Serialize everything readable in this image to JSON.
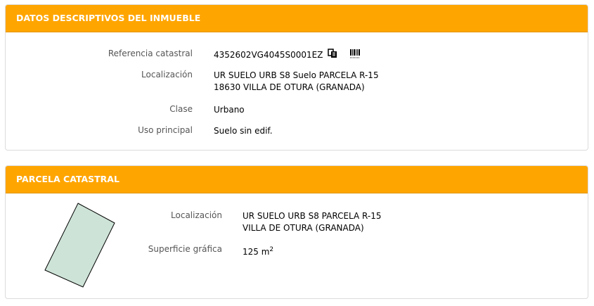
{
  "section1": {
    "title": "DATOS DESCRIPTIVOS DEL INMUEBLE",
    "rows": [
      {
        "label": "Referencia catastral",
        "value": "4352602VG4045S0001EZ"
      },
      {
        "label": "Localización",
        "value_line1": "UR SUELO URB S8 Suelo PARCELA R-15",
        "value_line2": "18630 VILLA DE OTURA (GRANADA)"
      },
      {
        "label": "Clase",
        "value": "Urbano"
      },
      {
        "label": "Uso principal",
        "value": "Suelo sin edif."
      }
    ]
  },
  "section2": {
    "title": "PARCELA CATASTRAL",
    "rows": [
      {
        "label": "Localización",
        "value_line1": "UR SUELO URB S8 PARCELA R-15",
        "value_line2": "VILLA DE OTURA (GRANADA)"
      },
      {
        "label": "Superficie gráfica",
        "value": "125 m",
        "unit_sup": "2"
      }
    ]
  },
  "colors": {
    "header": "#ffa500",
    "parcel_fill": "#cde3d7"
  },
  "icons": [
    "copy-icon",
    "barcode-icon"
  ]
}
